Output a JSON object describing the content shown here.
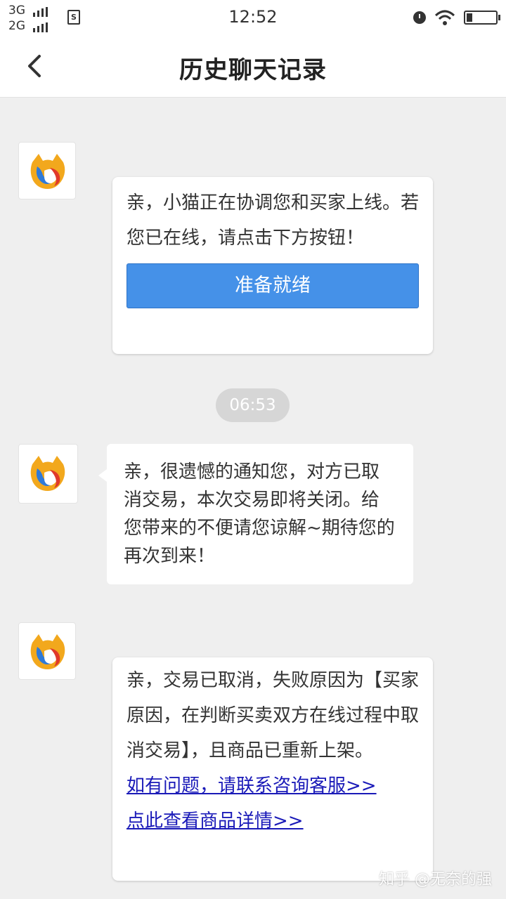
{
  "status_bar": {
    "net1": "3G",
    "net2": "2G",
    "sim_label": "S",
    "time": "12:52"
  },
  "header": {
    "title": "历史聊天记录",
    "back_icon": "chevron-left-icon"
  },
  "messages": [
    {
      "text": "亲，小猫正在协调您和买家上线。若您已在线，请点击下方按钮！",
      "button_label": "准备就绪"
    },
    {
      "timestamp": "06:53"
    },
    {
      "text": "亲，很遗憾的通知您，对方已取消交易，本次交易即将关闭。给您带来的不便请您谅解~期待您的再次到来！"
    },
    {
      "text": "亲，交易已取消，失败原因为【买家原因，在判断买卖双方在线过程中取消交易】，且商品已重新上架。",
      "link1": "如有问题，请联系咨询客服>>",
      "link2": "点此查看商品详情>>"
    }
  ],
  "watermark": "知乎 @无奈的强",
  "colors": {
    "accent_button": "#4591e8",
    "link": "#1a1ab8",
    "background": "#efefef"
  }
}
